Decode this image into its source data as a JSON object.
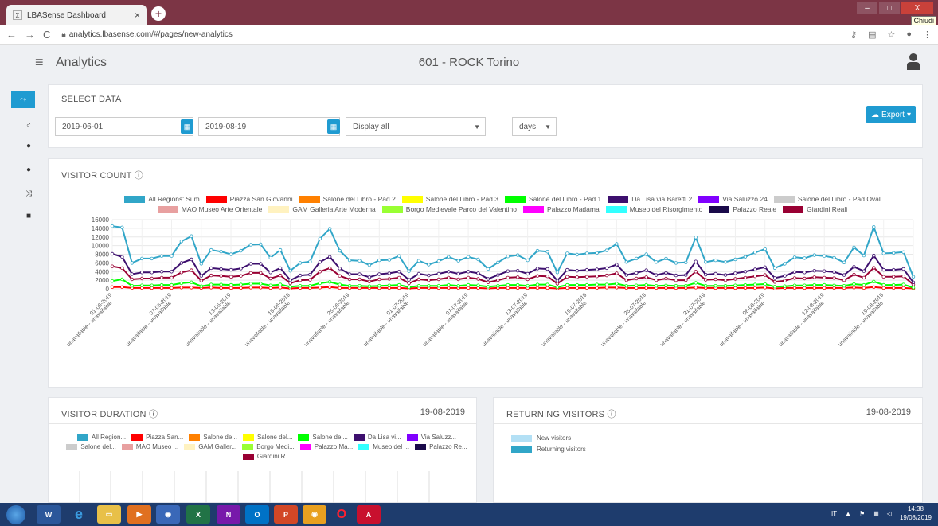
{
  "browser": {
    "tab_title": "LBASense Dashboard",
    "tab_close": "×",
    "new_tab": "+",
    "url": "analytics.lbasense.com/#/pages/new-analytics",
    "tooltip": "Chiudi",
    "win_min": "–",
    "win_max": "□",
    "win_close": "X"
  },
  "header": {
    "title": "Analytics",
    "location": "601 - ROCK Torino"
  },
  "select_data": {
    "title": "SELECT DATA",
    "start_date": "2019-06-01",
    "end_date": "2019-08-19",
    "display_option": "Display all",
    "granularity": "days",
    "export_label": "Export"
  },
  "visitor_count": {
    "title": "VISITOR COUNT",
    "legend": [
      {
        "label": "All Regions' Sum",
        "color": "#31a6c8"
      },
      {
        "label": "Piazza San Giovanni",
        "color": "#ff0000"
      },
      {
        "label": "Salone del Libro - Pad 2",
        "color": "#ff8000"
      },
      {
        "label": "Salone del Libro - Pad 3",
        "color": "#ffff00"
      },
      {
        "label": "Salone del Libro - Pad 1",
        "color": "#00ff00"
      },
      {
        "label": "Da Lisa via Baretti 2",
        "color": "#3d0f6e"
      },
      {
        "label": "Via Saluzzo 24",
        "color": "#8000ff"
      },
      {
        "label": "Salone del Libro - Pad Oval",
        "color": "#cccccc"
      },
      {
        "label": "MAO Museo Arte Orientale",
        "color": "#e8a0a0"
      },
      {
        "label": "GAM Galleria Arte Moderna",
        "color": "#fff2c0"
      },
      {
        "label": "Borgo Medievale Parco del Valentino",
        "color": "#99ff33"
      },
      {
        "label": "Palazzo Madama",
        "color": "#ff00ff"
      },
      {
        "label": "Museo del Risorgimento",
        "color": "#33ffff"
      },
      {
        "label": "Palazzo Reale",
        "color": "#1a0a4a"
      },
      {
        "label": "Giardini Reali",
        "color": "#990033"
      }
    ],
    "y_ticks": [
      "16000",
      "14000",
      "12000",
      "10000",
      "8000",
      "6000",
      "4000",
      "2000",
      "0"
    ],
    "x_labels": [
      "01-06-2019",
      "07-06-2019",
      "13-06-2019",
      "19-06-2019",
      "25-06-2019",
      "01-07-2019",
      "07-07-2019",
      "13-07-2019",
      "19-07-2019",
      "25-07-2019",
      "31-07-2019",
      "06-08-2019",
      "12-08-2019",
      "19-08-2019"
    ],
    "x_sublabel": "unavailable - unavailable"
  },
  "chart_data": {
    "type": "line",
    "ylim": [
      0,
      16000
    ],
    "x_label_step": 6,
    "series": [
      {
        "name": "All Regions' Sum",
        "color": "#31a6c8",
        "values": [
          14500,
          14200,
          6000,
          7000,
          7000,
          7600,
          7600,
          11000,
          12200,
          5800,
          9000,
          8600,
          8000,
          8800,
          10200,
          10300,
          7200,
          9000,
          4200,
          6000,
          6300,
          11600,
          13900,
          8800,
          6600,
          6500,
          5500,
          6600,
          6700,
          7600,
          4100,
          6500,
          5600,
          6400,
          7400,
          6500,
          7400,
          6800,
          4600,
          6100,
          7500,
          7800,
          6600,
          8800,
          8600,
          3800,
          8200,
          7900,
          8200,
          8300,
          8900,
          10400,
          6200,
          7000,
          8000,
          6200,
          7000,
          6000,
          6100,
          11900,
          6200,
          6600,
          6200,
          6800,
          7400,
          8400,
          9200,
          4800,
          5800,
          7300,
          7100,
          7800,
          7600,
          7200,
          6100,
          9600,
          7700,
          14300,
          8200,
          8300,
          8500,
          2800
        ]
      },
      {
        "name": "Da Lisa via Baretti 2",
        "color": "#3d0f6e",
        "values": [
          8100,
          7400,
          3400,
          3800,
          3800,
          4000,
          4000,
          6000,
          6800,
          3000,
          4800,
          4600,
          4400,
          4700,
          5800,
          5800,
          3800,
          4800,
          2000,
          3100,
          3300,
          6200,
          7400,
          4700,
          3400,
          3400,
          2700,
          3400,
          3600,
          4000,
          2100,
          3500,
          3100,
          3500,
          4000,
          3500,
          4000,
          3600,
          2300,
          3200,
          4100,
          4200,
          3500,
          4700,
          4600,
          1900,
          4400,
          4200,
          4400,
          4500,
          4800,
          5600,
          3200,
          3700,
          4300,
          3200,
          3700,
          3100,
          3200,
          6300,
          3300,
          3500,
          3200,
          3600,
          4000,
          4500,
          5000,
          2500,
          3000,
          3900,
          3800,
          4200,
          4100,
          3900,
          3200,
          5100,
          4100,
          7700,
          4400,
          4400,
          4600,
          1500
        ]
      },
      {
        "name": "Giardini Reali",
        "color": "#990033",
        "values": [
          5200,
          4800,
          2200,
          2400,
          2400,
          2600,
          2600,
          3800,
          4300,
          1900,
          3100,
          3000,
          2800,
          3000,
          3700,
          3700,
          2400,
          3100,
          1300,
          2000,
          2100,
          4000,
          4800,
          3000,
          2200,
          2200,
          1700,
          2200,
          2300,
          2600,
          1300,
          2200,
          2000,
          2200,
          2600,
          2200,
          2600,
          2300,
          1500,
          2000,
          2600,
          2700,
          2200,
          3000,
          2900,
          1200,
          2800,
          2700,
          2800,
          2900,
          3100,
          3600,
          2000,
          2400,
          2700,
          2000,
          2400,
          2000,
          2000,
          4000,
          2100,
          2200,
          2000,
          2300,
          2600,
          2900,
          3200,
          1600,
          1900,
          2500,
          2400,
          2700,
          2600,
          2500,
          2000,
          3300,
          2600,
          4900,
          2800,
          2800,
          2900,
          1000
        ]
      },
      {
        "name": "Salone del Libro - Pad 1",
        "color": "#00ff00",
        "values": [
          1800,
          2200,
          700,
          800,
          800,
          900,
          900,
          1300,
          1500,
          600,
          1000,
          1000,
          900,
          1000,
          1200,
          1200,
          800,
          1000,
          500,
          700,
          700,
          1300,
          1600,
          1000,
          700,
          700,
          600,
          700,
          800,
          900,
          400,
          700,
          700,
          700,
          900,
          700,
          900,
          800,
          500,
          700,
          900,
          900,
          700,
          1000,
          1000,
          400,
          900,
          900,
          900,
          1000,
          1000,
          1200,
          700,
          800,
          900,
          700,
          800,
          700,
          700,
          1400,
          700,
          700,
          700,
          800,
          900,
          1000,
          1100,
          500,
          600,
          800,
          800,
          900,
          900,
          800,
          700,
          1100,
          900,
          1700,
          900,
          900,
          1000,
          300
        ]
      },
      {
        "name": "Piazza San Giovanni",
        "color": "#ff0000",
        "values": [
          400,
          400,
          200,
          200,
          200,
          200,
          200,
          300,
          300,
          200,
          300,
          200,
          200,
          200,
          300,
          300,
          200,
          300,
          100,
          200,
          200,
          300,
          400,
          200,
          200,
          200,
          200,
          200,
          200,
          200,
          100,
          200,
          200,
          200,
          200,
          200,
          200,
          200,
          100,
          200,
          200,
          200,
          200,
          200,
          200,
          100,
          200,
          200,
          200,
          200,
          300,
          300,
          200,
          200,
          200,
          200,
          200,
          200,
          200,
          300,
          200,
          200,
          200,
          200,
          200,
          200,
          300,
          100,
          200,
          200,
          200,
          200,
          200,
          200,
          200,
          300,
          200,
          400,
          200,
          200,
          200,
          100
        ]
      }
    ]
  },
  "visitor_duration": {
    "title": "VISITOR DURATION",
    "date": "19-08-2019",
    "legend": [
      {
        "label": "All Region...",
        "color": "#31a6c8"
      },
      {
        "label": "Piazza San...",
        "color": "#ff0000"
      },
      {
        "label": "Salone de...",
        "color": "#ff8000"
      },
      {
        "label": "Salone del...",
        "color": "#ffff00"
      },
      {
        "label": "Salone del...",
        "color": "#00ff00"
      },
      {
        "label": "Da Lisa vi...",
        "color": "#3d0f6e"
      },
      {
        "label": "Via Saluzz...",
        "color": "#8000ff"
      },
      {
        "label": "Salone del...",
        "color": "#cccccc"
      },
      {
        "label": "MAO Museo ...",
        "color": "#e8a0a0"
      },
      {
        "label": "GAM Galler...",
        "color": "#fff2c0"
      },
      {
        "label": "Borgo Medi...",
        "color": "#99ff33"
      },
      {
        "label": "Palazzo Ma...",
        "color": "#ff00ff"
      },
      {
        "label": "Museo del ...",
        "color": "#33ffff"
      },
      {
        "label": "Palazzo Re...",
        "color": "#1a0a4a"
      },
      {
        "label": "Giardini R...",
        "color": "#990033"
      }
    ]
  },
  "returning_visitors": {
    "title": "RETURNING VISITORS",
    "date": "19-08-2019",
    "legend": [
      {
        "label": "New visitors",
        "color": "#b3e0f5"
      },
      {
        "label": "Returning visitors",
        "color": "#31a6c8"
      }
    ]
  },
  "taskbar": {
    "lang": "IT",
    "time": "14:38",
    "date": "19/08/2019"
  }
}
